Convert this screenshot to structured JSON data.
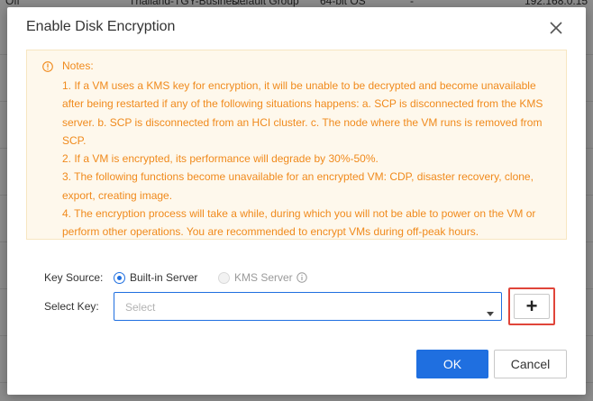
{
  "background_table": {
    "top_row": [
      "Off",
      "Thailand-TGY-Busines...",
      "Default Group",
      "64-bit OS",
      "-",
      "192.168.0.15"
    ]
  },
  "dialog": {
    "title": "Enable Disk Encryption",
    "close_icon": "close-icon",
    "notes": {
      "icon": "warning-info-icon",
      "title": "Notes:",
      "items": [
        "1. If a VM uses a KMS key for encryption, it will be unable to be decrypted and become unavailable after being restarted if any of the following situations happens: a. SCP is disconnected from the KMS server. b. SCP is disconnected from an HCI cluster. c. The node where the VM runs is removed from SCP.",
        "2. If a VM is encrypted, its performance will degrade by 30%-50%.",
        "3. The following functions become unavailable for an encrypted VM: CDP, disaster recovery, clone, export, creating image.",
        "4. The encryption process will take a while, during which you will not be able to power on the VM or perform other operations. You are recommended to encrypt VMs during off-peak hours."
      ]
    },
    "key_source": {
      "label": "Key Source:",
      "options": [
        {
          "label": "Built-in Server",
          "selected": true,
          "disabled": false
        },
        {
          "label": "KMS Server",
          "selected": false,
          "disabled": true
        }
      ]
    },
    "select_key": {
      "label": "Select Key:",
      "placeholder": "Select",
      "add_label": "+"
    },
    "buttons": {
      "ok": "OK",
      "cancel": "Cancel"
    }
  },
  "colors": {
    "primary": "#1f6fe0",
    "warning_text": "#f08a1c",
    "notes_bg": "#fef8ec",
    "highlight_border": "#e0453a"
  }
}
